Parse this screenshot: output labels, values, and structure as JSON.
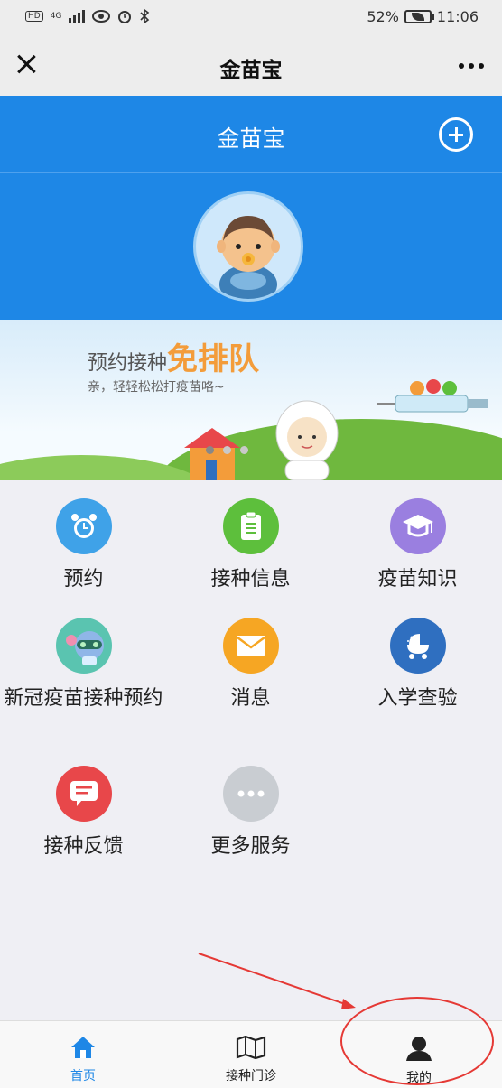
{
  "status_bar": {
    "left_labels": [
      "HD",
      "4G"
    ],
    "battery": "52%",
    "time": "11:06"
  },
  "titlebar": {
    "title": "金苗宝"
  },
  "header": {
    "title": "金苗宝"
  },
  "banner": {
    "title_prefix": "预约接种",
    "title_emphasis": "免排队",
    "subtitle": "亲，轻轻松松打疫苗咯~"
  },
  "grid": [
    {
      "label": "预约",
      "icon": "alarm-clock-icon",
      "color": "#3fa2e8"
    },
    {
      "label": "接种信息",
      "icon": "clipboard-icon",
      "color": "#5dbf3c"
    },
    {
      "label": "疫苗知识",
      "icon": "graduation-cap-icon",
      "color": "#9a7fe0"
    },
    {
      "label": "新冠疫苗接种预约",
      "icon": "mascot-icon",
      "color": "#5ac4b0"
    },
    {
      "label": "消息",
      "icon": "envelope-icon",
      "color": "#f6a623"
    },
    {
      "label": "入学查验",
      "icon": "stroller-icon",
      "color": "#2f6fc0"
    },
    {
      "label": "接种反馈",
      "icon": "chat-bubble-icon",
      "color": "#e8474a"
    },
    {
      "label": "更多服务",
      "icon": "more-dots-icon",
      "color": "#c9cdd2"
    }
  ],
  "bottom_nav": [
    {
      "label": "首页",
      "icon": "home-icon",
      "active": true
    },
    {
      "label": "接种门诊",
      "icon": "map-icon",
      "active": false
    },
    {
      "label": "我的",
      "icon": "person-icon",
      "active": false
    }
  ],
  "colors": {
    "brand_blue": "#1e87e6",
    "annotation_red": "#e53935"
  }
}
